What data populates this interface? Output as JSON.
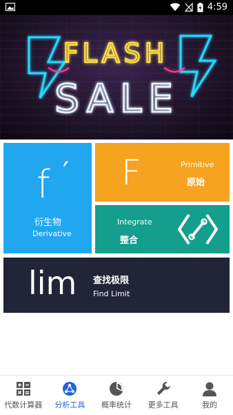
{
  "status_bar": {
    "time": "4:59"
  },
  "banner": {
    "line1": "FLASH",
    "line2": "SALE"
  },
  "tiles": {
    "derivative": {
      "symbol": "f",
      "prime": "′",
      "title_cn": "衍生物",
      "title_en": "Derivative"
    },
    "primitive": {
      "symbol": "F",
      "title_en": "Primitive",
      "title_cn": "原始"
    },
    "integrate": {
      "title_en": "Integrate",
      "title_cn": "整合"
    },
    "limit": {
      "symbol": "lim",
      "title_cn": "查找极限",
      "title_en": "Find Limit"
    }
  },
  "bottom_nav": {
    "items": [
      {
        "label": "代数计算器",
        "icon": "calculator-icon"
      },
      {
        "label": "分析工具",
        "icon": "analysis-icon",
        "active": true
      },
      {
        "label": "概率统计",
        "icon": "pie-chart-icon"
      },
      {
        "label": "更多工具",
        "icon": "wrench-icon"
      },
      {
        "label": "我的",
        "icon": "person-icon"
      }
    ]
  },
  "colors": {
    "derivative": "#21a7f0",
    "primitive": "#f5a320",
    "integrate": "#139f8c",
    "limit": "#222437",
    "active_nav": "#2462e0"
  }
}
